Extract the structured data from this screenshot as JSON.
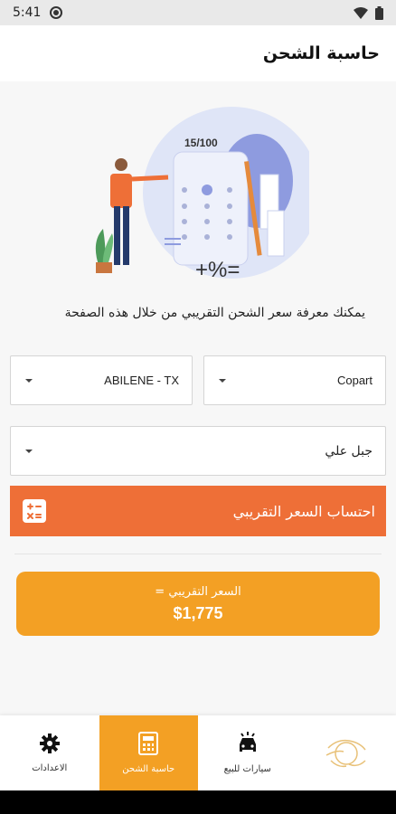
{
  "status_bar": {
    "time": "5:41"
  },
  "header": {
    "title": "حاسبة الشحن"
  },
  "intro": {
    "text": "يمكنك معرفة سعر الشحن التقريبي من خلال هذه الصفحة",
    "illustration_score": "15/100",
    "illustration_symbols": "+%="
  },
  "form": {
    "auction": {
      "value": "Copart"
    },
    "location": {
      "value": "ABILENE - TX"
    },
    "destination": {
      "value": "جبل علي"
    }
  },
  "calculate_button": {
    "label": "احتساب السعر التقريبي"
  },
  "result": {
    "label": "السعر التقريبي =",
    "value": "$1,775"
  },
  "bottom_nav": {
    "items": [
      {
        "label": "",
        "icon": "brand-logo-icon"
      },
      {
        "label": "سيارات للبيع",
        "icon": "car-icon"
      },
      {
        "label": "حاسبة الشحن",
        "icon": "calculator-icon",
        "active": true
      },
      {
        "label": "الاعدادات",
        "icon": "gear-icon"
      }
    ]
  },
  "colors": {
    "accent_orange": "#ee6f37",
    "accent_amber": "#f3a024"
  }
}
